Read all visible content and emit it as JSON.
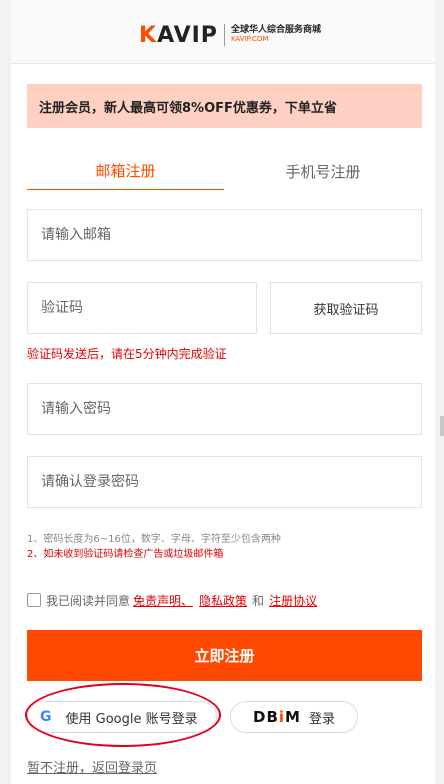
{
  "header": {
    "logo_prefix": "K",
    "logo_rest": "AVIP",
    "slogan": "全球华人综合服务商城",
    "domain": "KAVIP.COM"
  },
  "promo": {
    "text": "注册会员，新人最高可领8%OFF优惠券，下单立省"
  },
  "tabs": [
    {
      "label": "邮箱注册",
      "active": true
    },
    {
      "label": "手机号注册",
      "active": false
    }
  ],
  "form": {
    "email_placeholder": "请输入邮箱",
    "code_placeholder": "验证码",
    "get_code_label": "获取验证码",
    "code_hint": "验证码发送后，请在5分钟内完成验证",
    "password_placeholder": "请输入密码",
    "confirm_placeholder": "请确认登录密码",
    "note1": "1、密码长度为6~16位，数字、字母、字符至少包含两种",
    "note2": "2、如未收到验证码请检查广告或垃圾邮件箱"
  },
  "agreement": {
    "prefix": "我已阅读并同意",
    "link1": "免责声明、",
    "link2": "隐私政策",
    "and": "和",
    "link3": "注册协议",
    "checked": false
  },
  "submit_label": "立即注册",
  "social": {
    "google_icon": "G",
    "google_label": "使用 Google 账号登录",
    "dbim_logo_a": "DB",
    "dbim_logo_i": "i",
    "dbim_logo_m": "M",
    "dbim_label": "登录"
  },
  "back_link": "暂不注册，返回登录页",
  "colors": {
    "accent": "#ff4a00",
    "promo_bg": "#ffd1c2",
    "error": "#e60000",
    "highlight_ellipse": "#e3001b"
  }
}
